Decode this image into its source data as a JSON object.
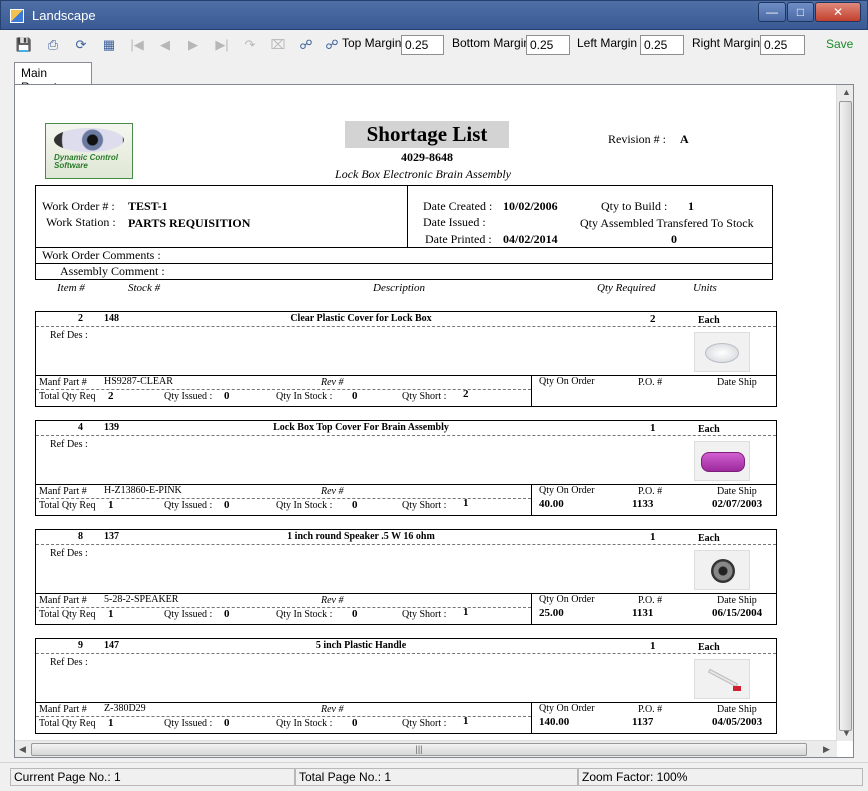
{
  "window": {
    "title": "Landscape"
  },
  "toolbar": {
    "top_margin_label": "Top Margin",
    "top_margin": "0.25",
    "bottom_margin_label": "Bottom Margin",
    "bottom_margin": "0.25",
    "left_margin_label": "Left Margin",
    "left_margin": "0.25",
    "right_margin_label": "Right Margin",
    "right_margin": "0.25",
    "save_label": "Save",
    "icons": [
      "export-icon",
      "print-icon",
      "refresh-icon",
      "tree-icon",
      "first-page-icon",
      "prev-page-icon",
      "next-page-icon",
      "last-page-icon",
      "goto-icon",
      "stop-icon",
      "find-icon",
      "find-next-icon"
    ]
  },
  "tabs": [
    {
      "label": "Main Report"
    }
  ],
  "report": {
    "logo_text": "Dynamic Control Software",
    "title": "Shortage List",
    "part_number": "4029-8648",
    "part_description": "Lock Box Electronic Brain Assembly",
    "revision_label": "Revision # :",
    "revision": "A",
    "work_order_label": "Work Order # :",
    "work_order": "TEST-1",
    "work_station_label": "Work Station :",
    "work_station": "PARTS REQUISITION",
    "date_created_label": "Date Created :",
    "date_created": "10/02/2006",
    "date_issued_label": "Date Issued :",
    "date_printed_label": "Date Printed :",
    "date_printed": "04/02/2014",
    "qty_to_build_label": "Qty to Build :",
    "qty_to_build": "1",
    "qty_assembled_label": "Qty Assembled Transfered To Stock",
    "qty_assembled": "0",
    "wo_comments_label": "Work Order Comments :",
    "assembly_comment_label": "Assembly Comment :",
    "columns": {
      "item": "Item #",
      "stock": "Stock #",
      "description": "Description",
      "qty_required": "Qty Required",
      "units": "Units"
    },
    "labels": {
      "ref_des": "Ref Des :",
      "manf_part": "Manf Part #",
      "rev": "Rev #",
      "total_qty_req": "Total Qty Req",
      "qty_issued": "Qty Issued :",
      "qty_in_stock": "Qty In Stock :",
      "qty_short": "Qty Short :",
      "qty_on_order": "Qty On Order",
      "po": "P.O. #",
      "date_ship": "Date Ship"
    },
    "items": [
      {
        "item": "2",
        "stock": "148",
        "description": "Clear Plastic Cover for Lock Box",
        "qty_required": "2",
        "units": "Each",
        "manf_part": "HS9287-CLEAR",
        "total_qty_req": "2",
        "qty_issued": "0",
        "qty_in_stock": "0",
        "qty_short": "2",
        "qty_on_order": "",
        "po": "",
        "date_ship": "",
        "image": "clear-cover"
      },
      {
        "item": "4",
        "stock": "139",
        "description": "Lock Box Top Cover For Brain Assembly",
        "qty_required": "1",
        "units": "Each",
        "manf_part": "H-Z13860-E-PINK",
        "total_qty_req": "1",
        "qty_issued": "0",
        "qty_in_stock": "0",
        "qty_short": "1",
        "qty_on_order": "40.00",
        "po": "1133",
        "date_ship": "02/07/2003",
        "image": "pink-cover"
      },
      {
        "item": "8",
        "stock": "137",
        "description": "1 inch round Speaker .5 W 16 ohm",
        "qty_required": "1",
        "units": "Each",
        "manf_part": "5-28-2-SPEAKER",
        "total_qty_req": "1",
        "qty_issued": "0",
        "qty_in_stock": "0",
        "qty_short": "1",
        "qty_on_order": "25.00",
        "po": "1131",
        "date_ship": "06/15/2004",
        "image": "speaker"
      },
      {
        "item": "9",
        "stock": "147",
        "description": "5 inch Plastic Handle",
        "qty_required": "1",
        "units": "Each",
        "manf_part": "Z-380D29",
        "total_qty_req": "1",
        "qty_issued": "0",
        "qty_in_stock": "0",
        "qty_short": "1",
        "qty_on_order": "140.00",
        "po": "1137",
        "date_ship": "04/05/2003",
        "image": "handle"
      }
    ]
  },
  "status": {
    "current_page": "Current Page No.: 1",
    "total_page": "Total Page No.: 1",
    "zoom": "Zoom Factor: 100%"
  }
}
